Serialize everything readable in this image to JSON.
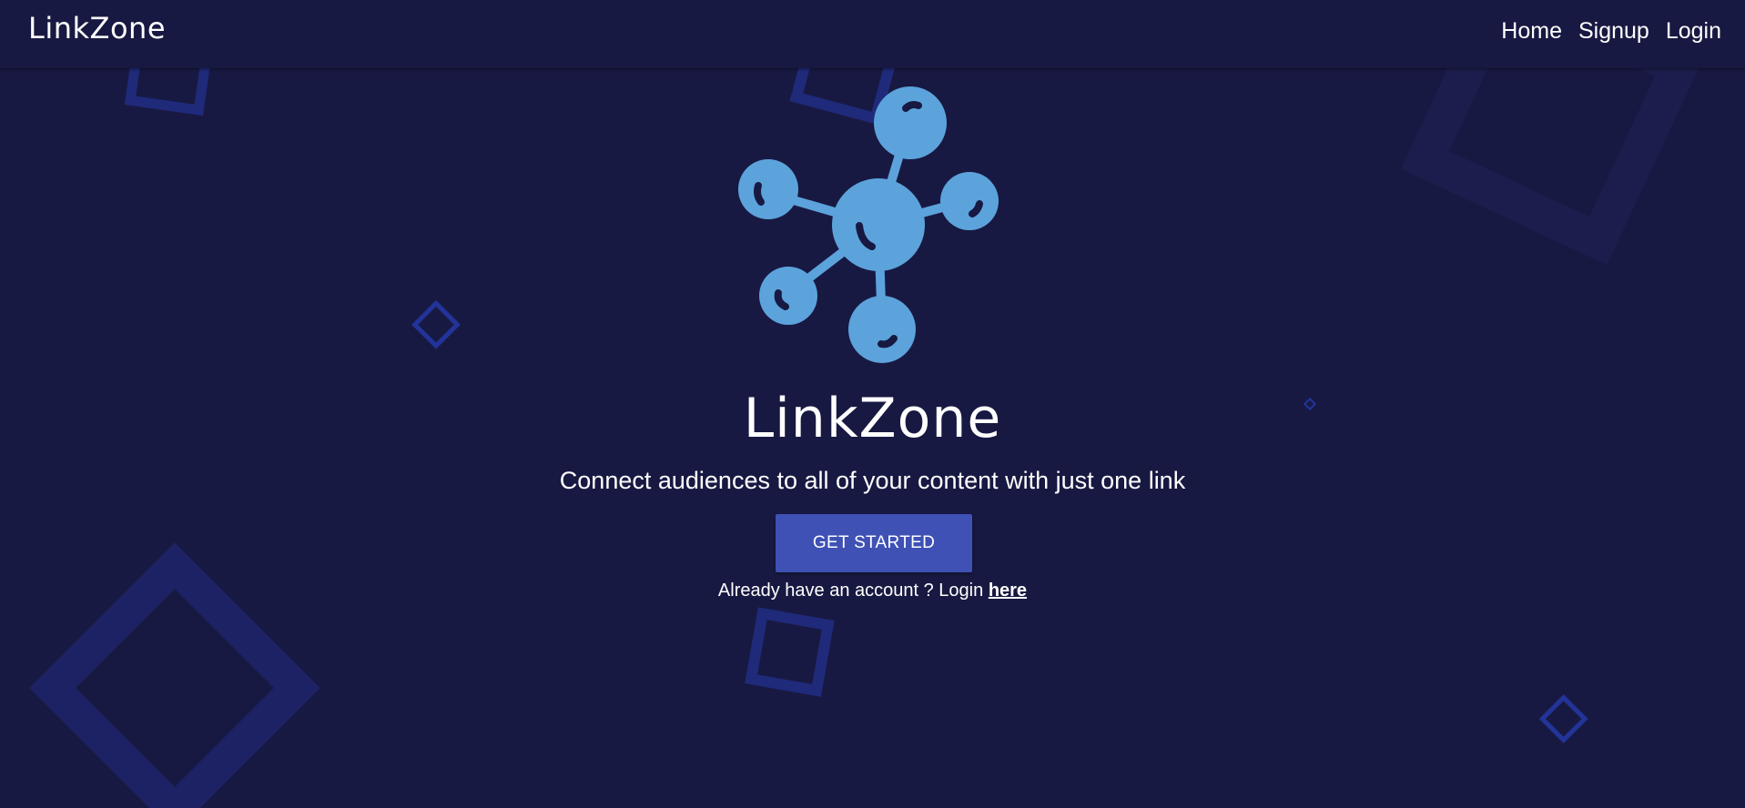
{
  "navbar": {
    "brand": "LinkZone",
    "links": [
      "Home",
      "Signup",
      "Login"
    ]
  },
  "hero": {
    "title": "LinkZone",
    "subtitle": "Connect audiences to all of your content with just one link",
    "cta_label": "GET STARTED",
    "login_prompt": "Already have an account ? Login",
    "login_link": "here"
  },
  "icons": {
    "logo": "molecule-network-icon"
  },
  "colors": {
    "background": "#181942",
    "accent": "#3f51b5",
    "logo": "#5ca3dc",
    "shape_outline": "#1f2a7a"
  }
}
